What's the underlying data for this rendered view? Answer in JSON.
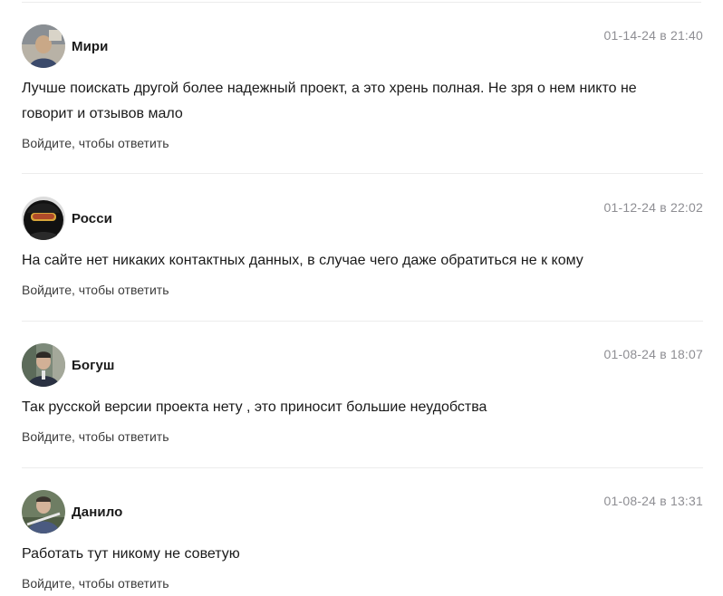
{
  "comments": [
    {
      "author": "Мири",
      "timestamp": "01-14-24 в 21:40",
      "text": "Лучше поискать другой более надежный проект, а это хрень полная. Не зря о нем никто не говорит и отзывов мало",
      "reply_label": "Войдите, чтобы ответить",
      "avatar_color": "#6b7d8e"
    },
    {
      "author": "Росси",
      "timestamp": "01-12-24 в 22:02",
      "text": "На сайте нет никаких контактных данных, в случае чего даже обратиться не к кому",
      "reply_label": "Войдите, чтобы ответить",
      "avatar_color": "#1b1b1b"
    },
    {
      "author": "Богуш",
      "timestamp": "01-08-24 в 18:07",
      "text": "Так русской версии проекта нету , это приносит большие неудобства",
      "reply_label": "Войдите, чтобы ответить",
      "avatar_color": "#4a5566"
    },
    {
      "author": "Данило",
      "timestamp": "01-08-24 в 13:31",
      "text": "Работать тут никому не советую",
      "reply_label": "Войдите, чтобы ответить",
      "avatar_color": "#5a6a52"
    }
  ]
}
